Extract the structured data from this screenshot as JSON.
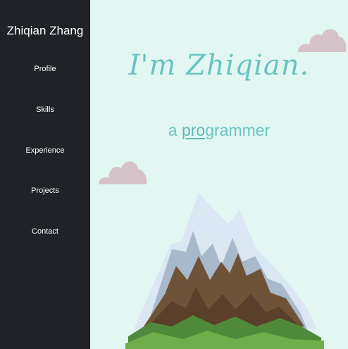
{
  "sidebar": {
    "brand": "Zhiqian Zhang",
    "items": [
      {
        "label": "Profile"
      },
      {
        "label": "Skills"
      },
      {
        "label": "Experience"
      },
      {
        "label": "Projects"
      },
      {
        "label": "Contact"
      }
    ]
  },
  "hero": {
    "headline": "I'm Zhiqian.",
    "subtitle_prefix": "a ",
    "subtitle_highlight": "pro",
    "subtitle_rest": "grammer"
  },
  "colors": {
    "sidebar_bg": "#1f2327",
    "main_bg": "#e2f7f1",
    "accent": "#6cc3c1",
    "cloud": "#d6c3c9"
  },
  "decorations": [
    "cloud-icon",
    "cloud-icon",
    "mountain-icon"
  ]
}
